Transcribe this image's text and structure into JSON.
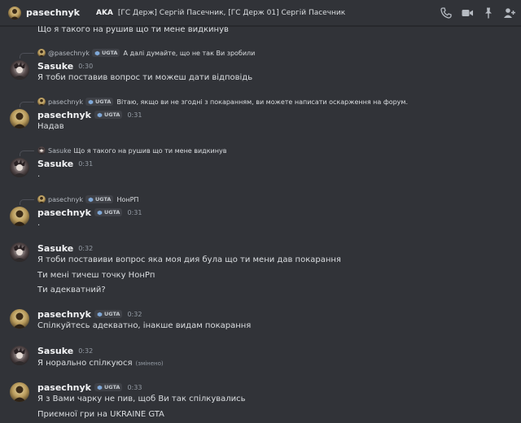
{
  "header": {
    "username": "pasechnyk",
    "aka_badge": "AKA",
    "aka_names": "[ГС Держ] Сергій Пасечник, [ГС Держ 01] Сергій Пасечник"
  },
  "server_tag": "UGTA",
  "messages": [
    {
      "lines": [
        "Що я такого на рушив що ти мене видкинув"
      ]
    },
    {
      "reply": {
        "name": "@pasechnyk",
        "has_tag": true,
        "text": "А далі думайте, що не так Ви зробили"
      },
      "author": "Sasuke",
      "time": "0:30",
      "lines": [
        "Я тоби поставив вопрос ти можеш дати відповідь"
      ]
    },
    {
      "reply": {
        "name": "pasechnyk",
        "has_tag": true,
        "text": "Вітаю, якщо ви не згодні з покаранням, ви можете написати оскарження на форум."
      },
      "author": "pasechnyk",
      "time": "0:31",
      "lines": [
        "Надав"
      ]
    },
    {
      "reply": {
        "name": "Sasuke",
        "has_tag": false,
        "text": "Що я такого на рушив що ти мене видкинув"
      },
      "author": "Sasuke",
      "time": "0:31",
      "lines": [
        "."
      ]
    },
    {
      "reply": {
        "name": "pasechnyk",
        "has_tag": true,
        "text": "НонРП"
      },
      "author": "pasechnyk",
      "time": "0:31",
      "lines": [
        "."
      ]
    },
    {
      "author": "Sasuke",
      "time": "0:32",
      "lines": [
        "Я тоби поставиви вопрос яка моя дия була що ти мени дав покарання",
        "Ти мені тичеш точку НонРп",
        "Ти адекватний?"
      ]
    },
    {
      "author": "pasechnyk",
      "time": "0:32",
      "lines": [
        "Спілкуйтесь адекватно, інакше видам покарання"
      ]
    },
    {
      "author": "Sasuke",
      "time": "0:32",
      "lines": [
        "Я норально спілкуюся"
      ],
      "edited": "(змінено)"
    },
    {
      "author": "pasechnyk",
      "time": "0:33",
      "lines": [
        "Я з Вами чарку не пив, щоб Ви так спілкувались",
        "Приємної гри на UKRAINE GTA"
      ]
    }
  ],
  "colors": {
    "background": "#313338",
    "text": "#dbdee1",
    "author": "#f2f3f5",
    "muted": "#949ba4",
    "tag_bg": "#3f4147"
  },
  "icons": [
    "phone-icon",
    "video-icon",
    "pin-icon",
    "add-user-icon"
  ]
}
